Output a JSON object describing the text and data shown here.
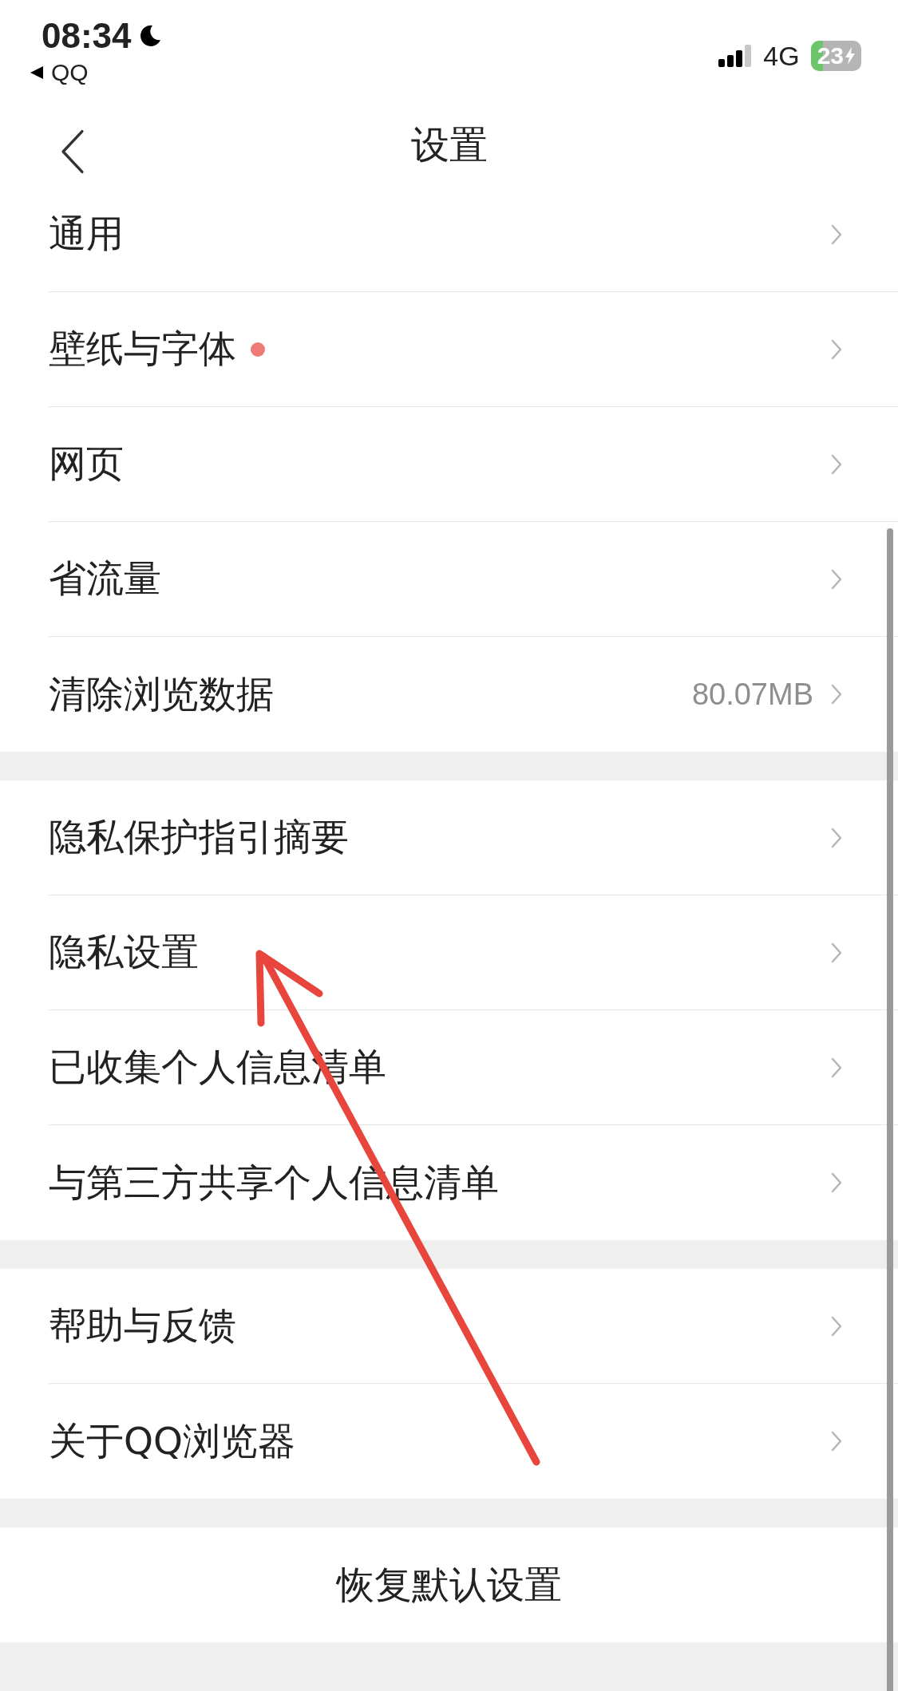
{
  "status_bar": {
    "time": "08:34",
    "back_app": "QQ",
    "network": "4G",
    "battery": "23"
  },
  "header": {
    "title": "设置"
  },
  "sections": [
    {
      "items": [
        {
          "label": "通用",
          "dot": false
        },
        {
          "label": "壁纸与字体",
          "dot": true
        },
        {
          "label": "网页",
          "dot": false
        },
        {
          "label": "省流量",
          "dot": false
        },
        {
          "label": "清除浏览数据",
          "value": "80.07MB",
          "dot": false
        }
      ]
    },
    {
      "items": [
        {
          "label": "隐私保护指引摘要",
          "dot": false
        },
        {
          "label": "隐私设置",
          "dot": false
        },
        {
          "label": "已收集个人信息清单",
          "dot": false
        },
        {
          "label": "与第三方共享个人信息清单",
          "dot": false
        }
      ]
    },
    {
      "items": [
        {
          "label": "帮助与反馈",
          "dot": false
        },
        {
          "label": "关于QQ浏览器",
          "dot": false
        }
      ]
    }
  ],
  "restore_button": "恢复默认设置"
}
